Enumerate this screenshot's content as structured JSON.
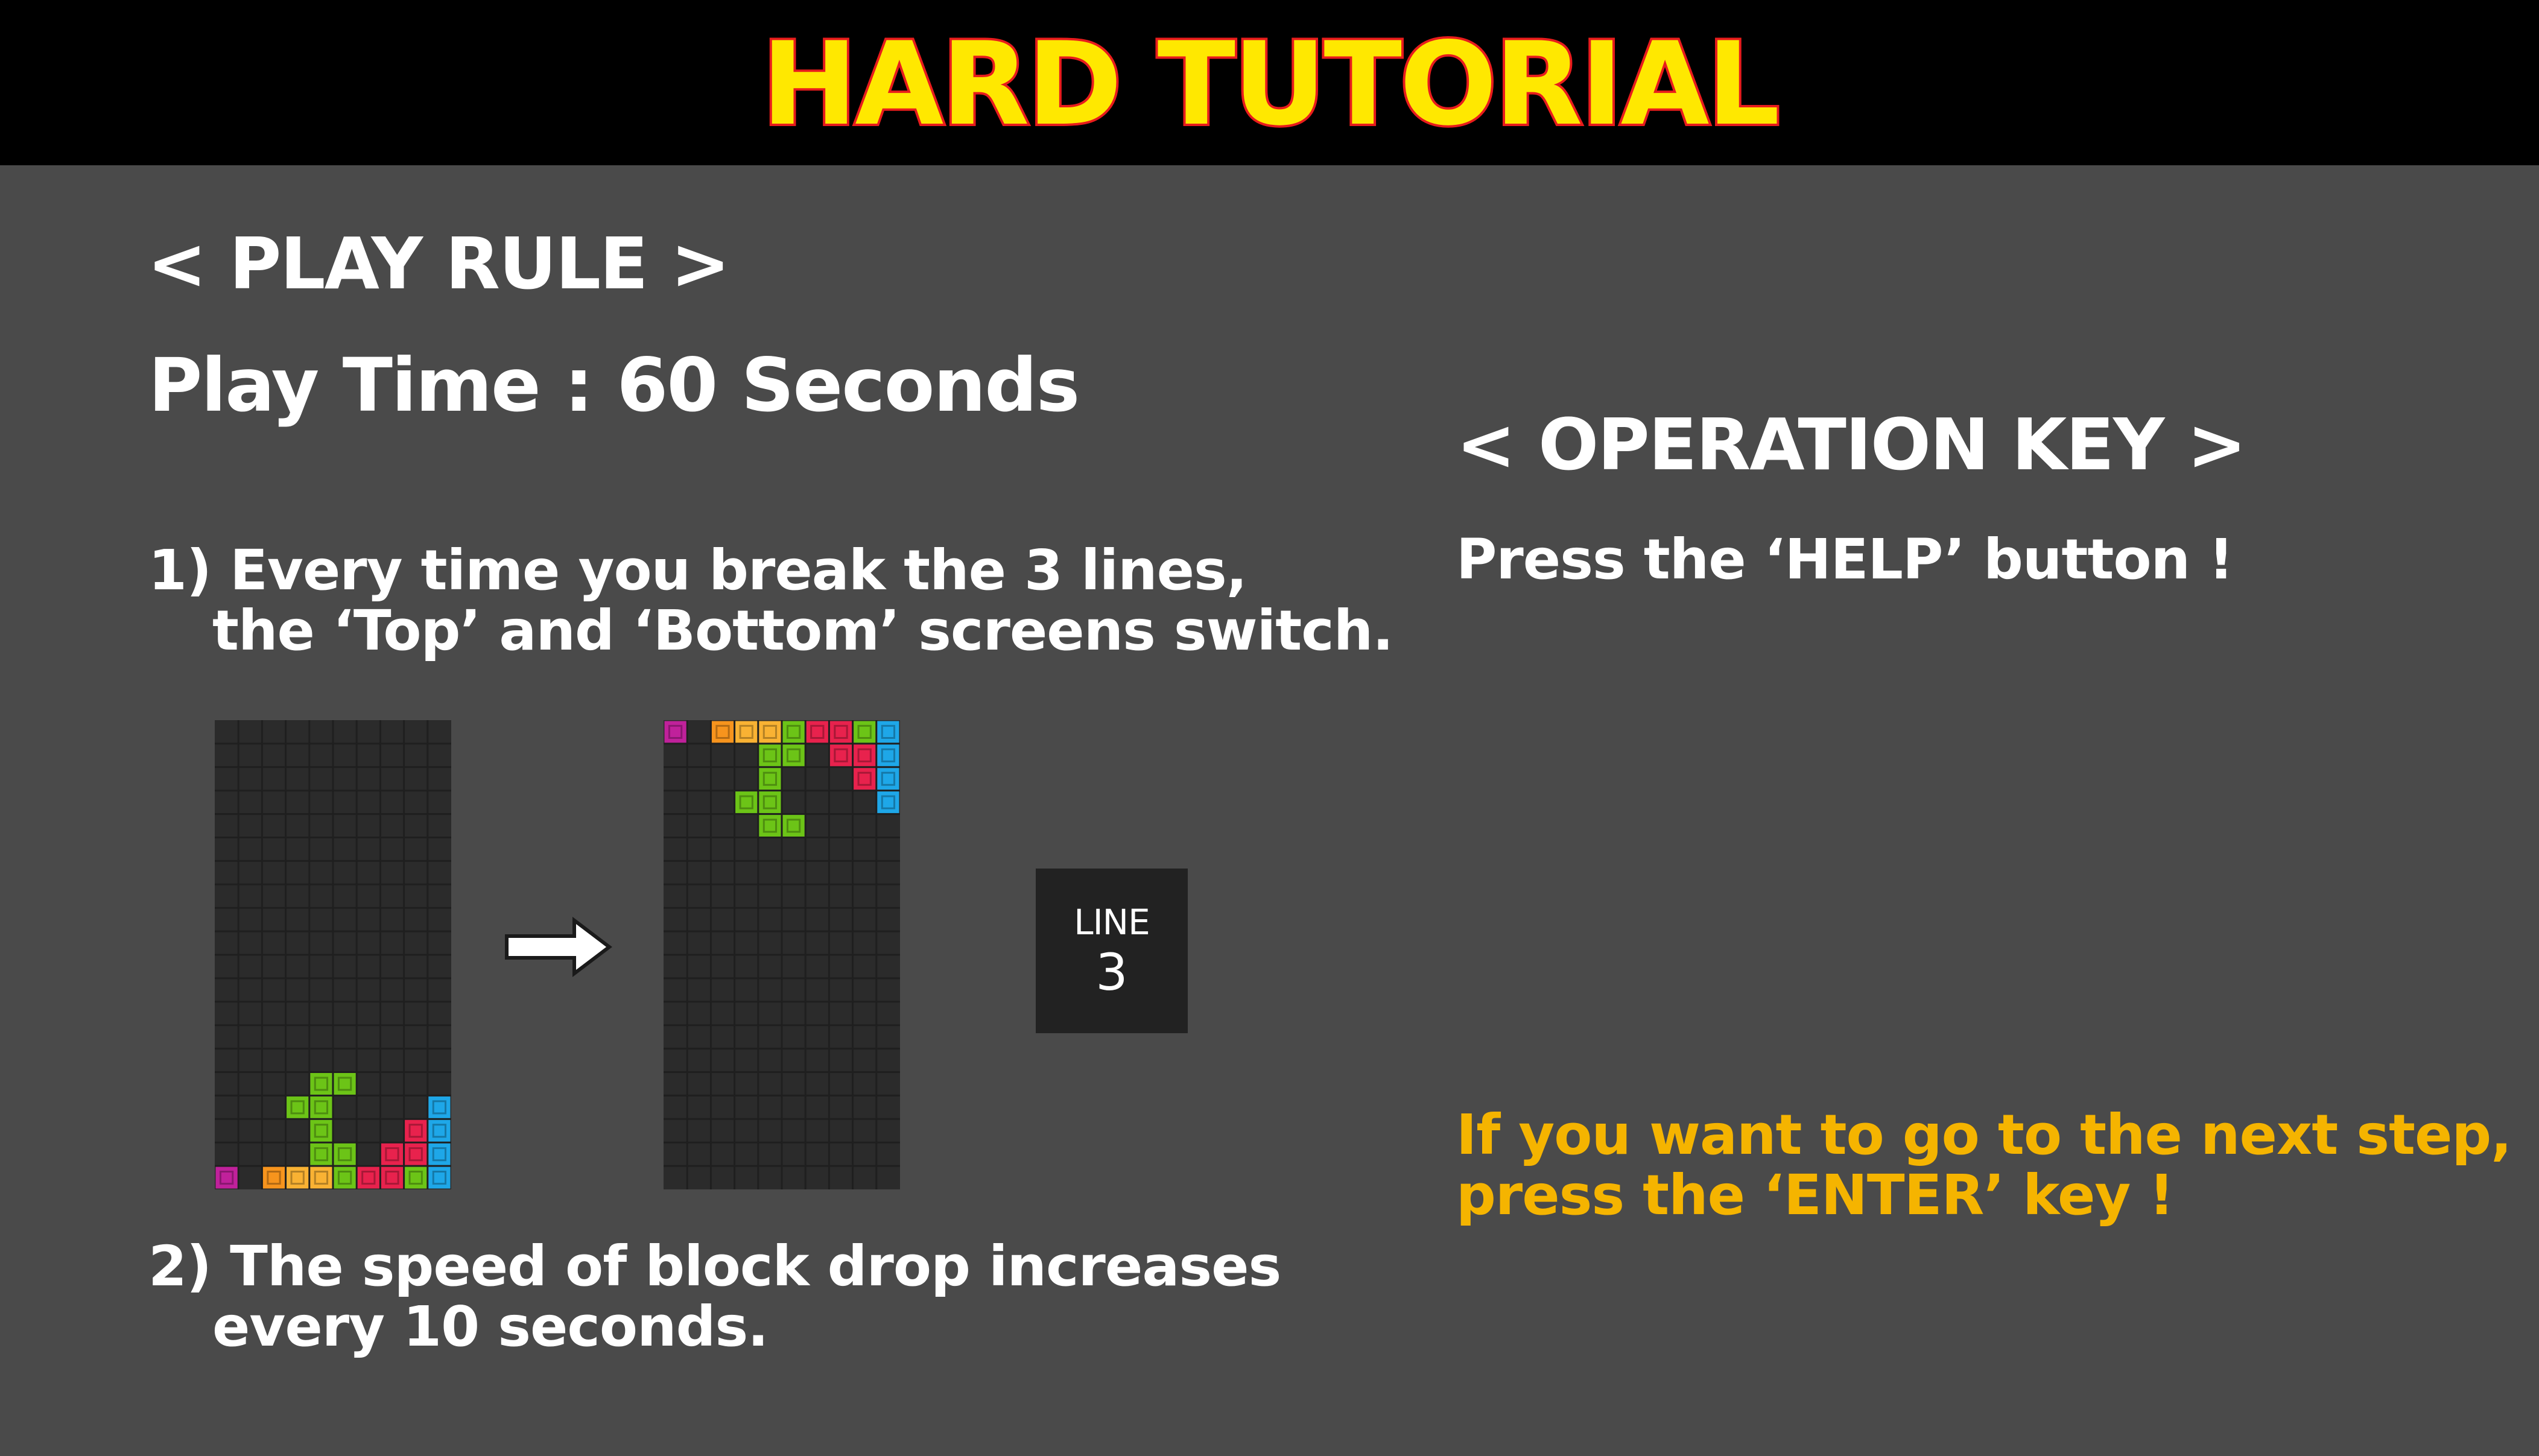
{
  "header": {
    "title": "HARD TUTORIAL"
  },
  "play_rule": {
    "title": "< PLAY RULE >",
    "play_time": "Play Time : 60 Seconds",
    "rule1_line1": "1) Every time you break the 3 lines,",
    "rule1_line2": "the ‘Top’ and ‘Bottom’ screens switch.",
    "rule2_line1": "2) The speed of block drop increases",
    "rule2_line2": "every 10 seconds."
  },
  "operation_key": {
    "title": "< OPERATION KEY >",
    "help_text": "Press the  ‘HELP’ button !"
  },
  "next_step": {
    "line1": "If you want to go to the next step,",
    "line2": "press the ‘ENTER’ key !"
  },
  "line_counter": {
    "label": "LINE",
    "value": "3"
  },
  "colors": {
    "background": "#4a4a4a",
    "header_bg": "#000000",
    "title_fill": "#ffe800",
    "title_stroke": "#e81c1c",
    "next_step_text": "#f5b400",
    "board_bg": "#2b2b2b",
    "grid_line": "#1f1f1f",
    "block_green": "#6cc417",
    "block_orange": "#f7941d",
    "block_yellow": "#f9b233",
    "block_red": "#e8224d",
    "block_blue": "#1ea7e8",
    "block_magenta": "#c0219b"
  },
  "icons": {
    "switch_arrow": "right-arrow-icon"
  }
}
